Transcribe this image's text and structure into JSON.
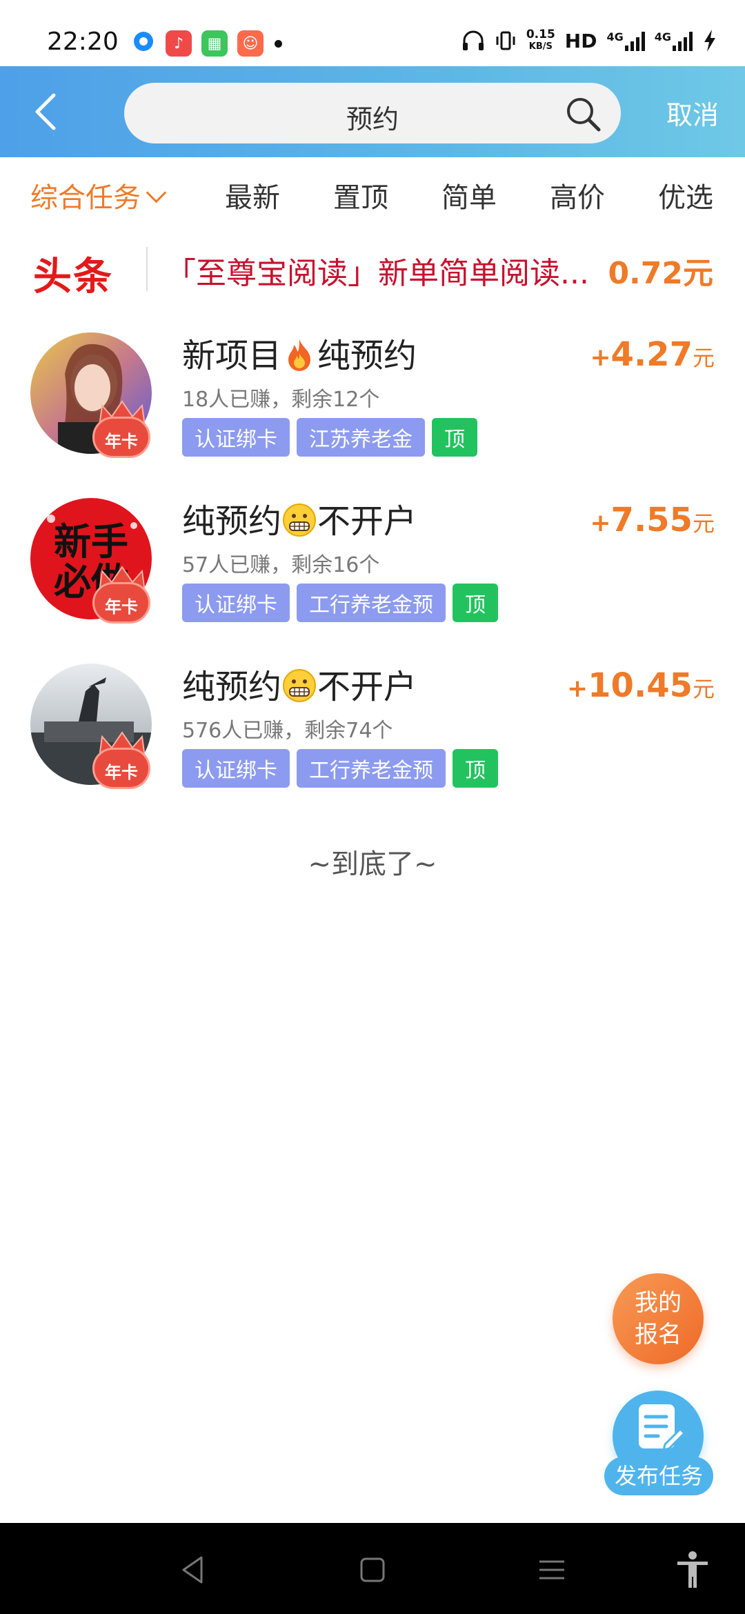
{
  "status_bar": {
    "time": "22:20",
    "net_speed_value": "0.15",
    "net_speed_unit": "KB/S",
    "hd_label": "HD",
    "net1": "4G",
    "net2": "4G"
  },
  "header": {
    "search_value": "预约",
    "cancel_label": "取消"
  },
  "tabs": [
    {
      "label": "综合任务"
    },
    {
      "label": "最新"
    },
    {
      "label": "置顶"
    },
    {
      "label": "简单"
    },
    {
      "label": "高价"
    },
    {
      "label": "优选"
    }
  ],
  "headline": {
    "logo": "头条",
    "text": "「至尊宝阅读」新单简单阅读...",
    "price": "0.72元"
  },
  "tasks": [
    {
      "title_a": "新项目",
      "title_b": "纯预约",
      "meta": "18人已赚，剩余12个",
      "tags": [
        "认证绑卡",
        "江苏养老金"
      ],
      "top_tag": "顶",
      "price": "4.27",
      "badge": "年卡"
    },
    {
      "title_a": "纯预约",
      "title_b": "不开户",
      "meta": "57人已赚，剩余16个",
      "tags": [
        "认证绑卡",
        "工行养老金预"
      ],
      "top_tag": "顶",
      "price": "7.55",
      "badge": "年卡",
      "avatar_text": "新手必做"
    },
    {
      "title_a": "纯预约",
      "title_b": "不开户",
      "meta": "576人已赚，剩余74个",
      "tags": [
        "认证绑卡",
        "工行养老金预"
      ],
      "top_tag": "顶",
      "price": "10.45",
      "badge": "年卡"
    }
  ],
  "price_plus": "+",
  "price_unit": "元",
  "end_text": "~到底了~",
  "fab": {
    "mine_line1": "我的",
    "mine_line2": "报名",
    "publish_label": "发布任务"
  }
}
